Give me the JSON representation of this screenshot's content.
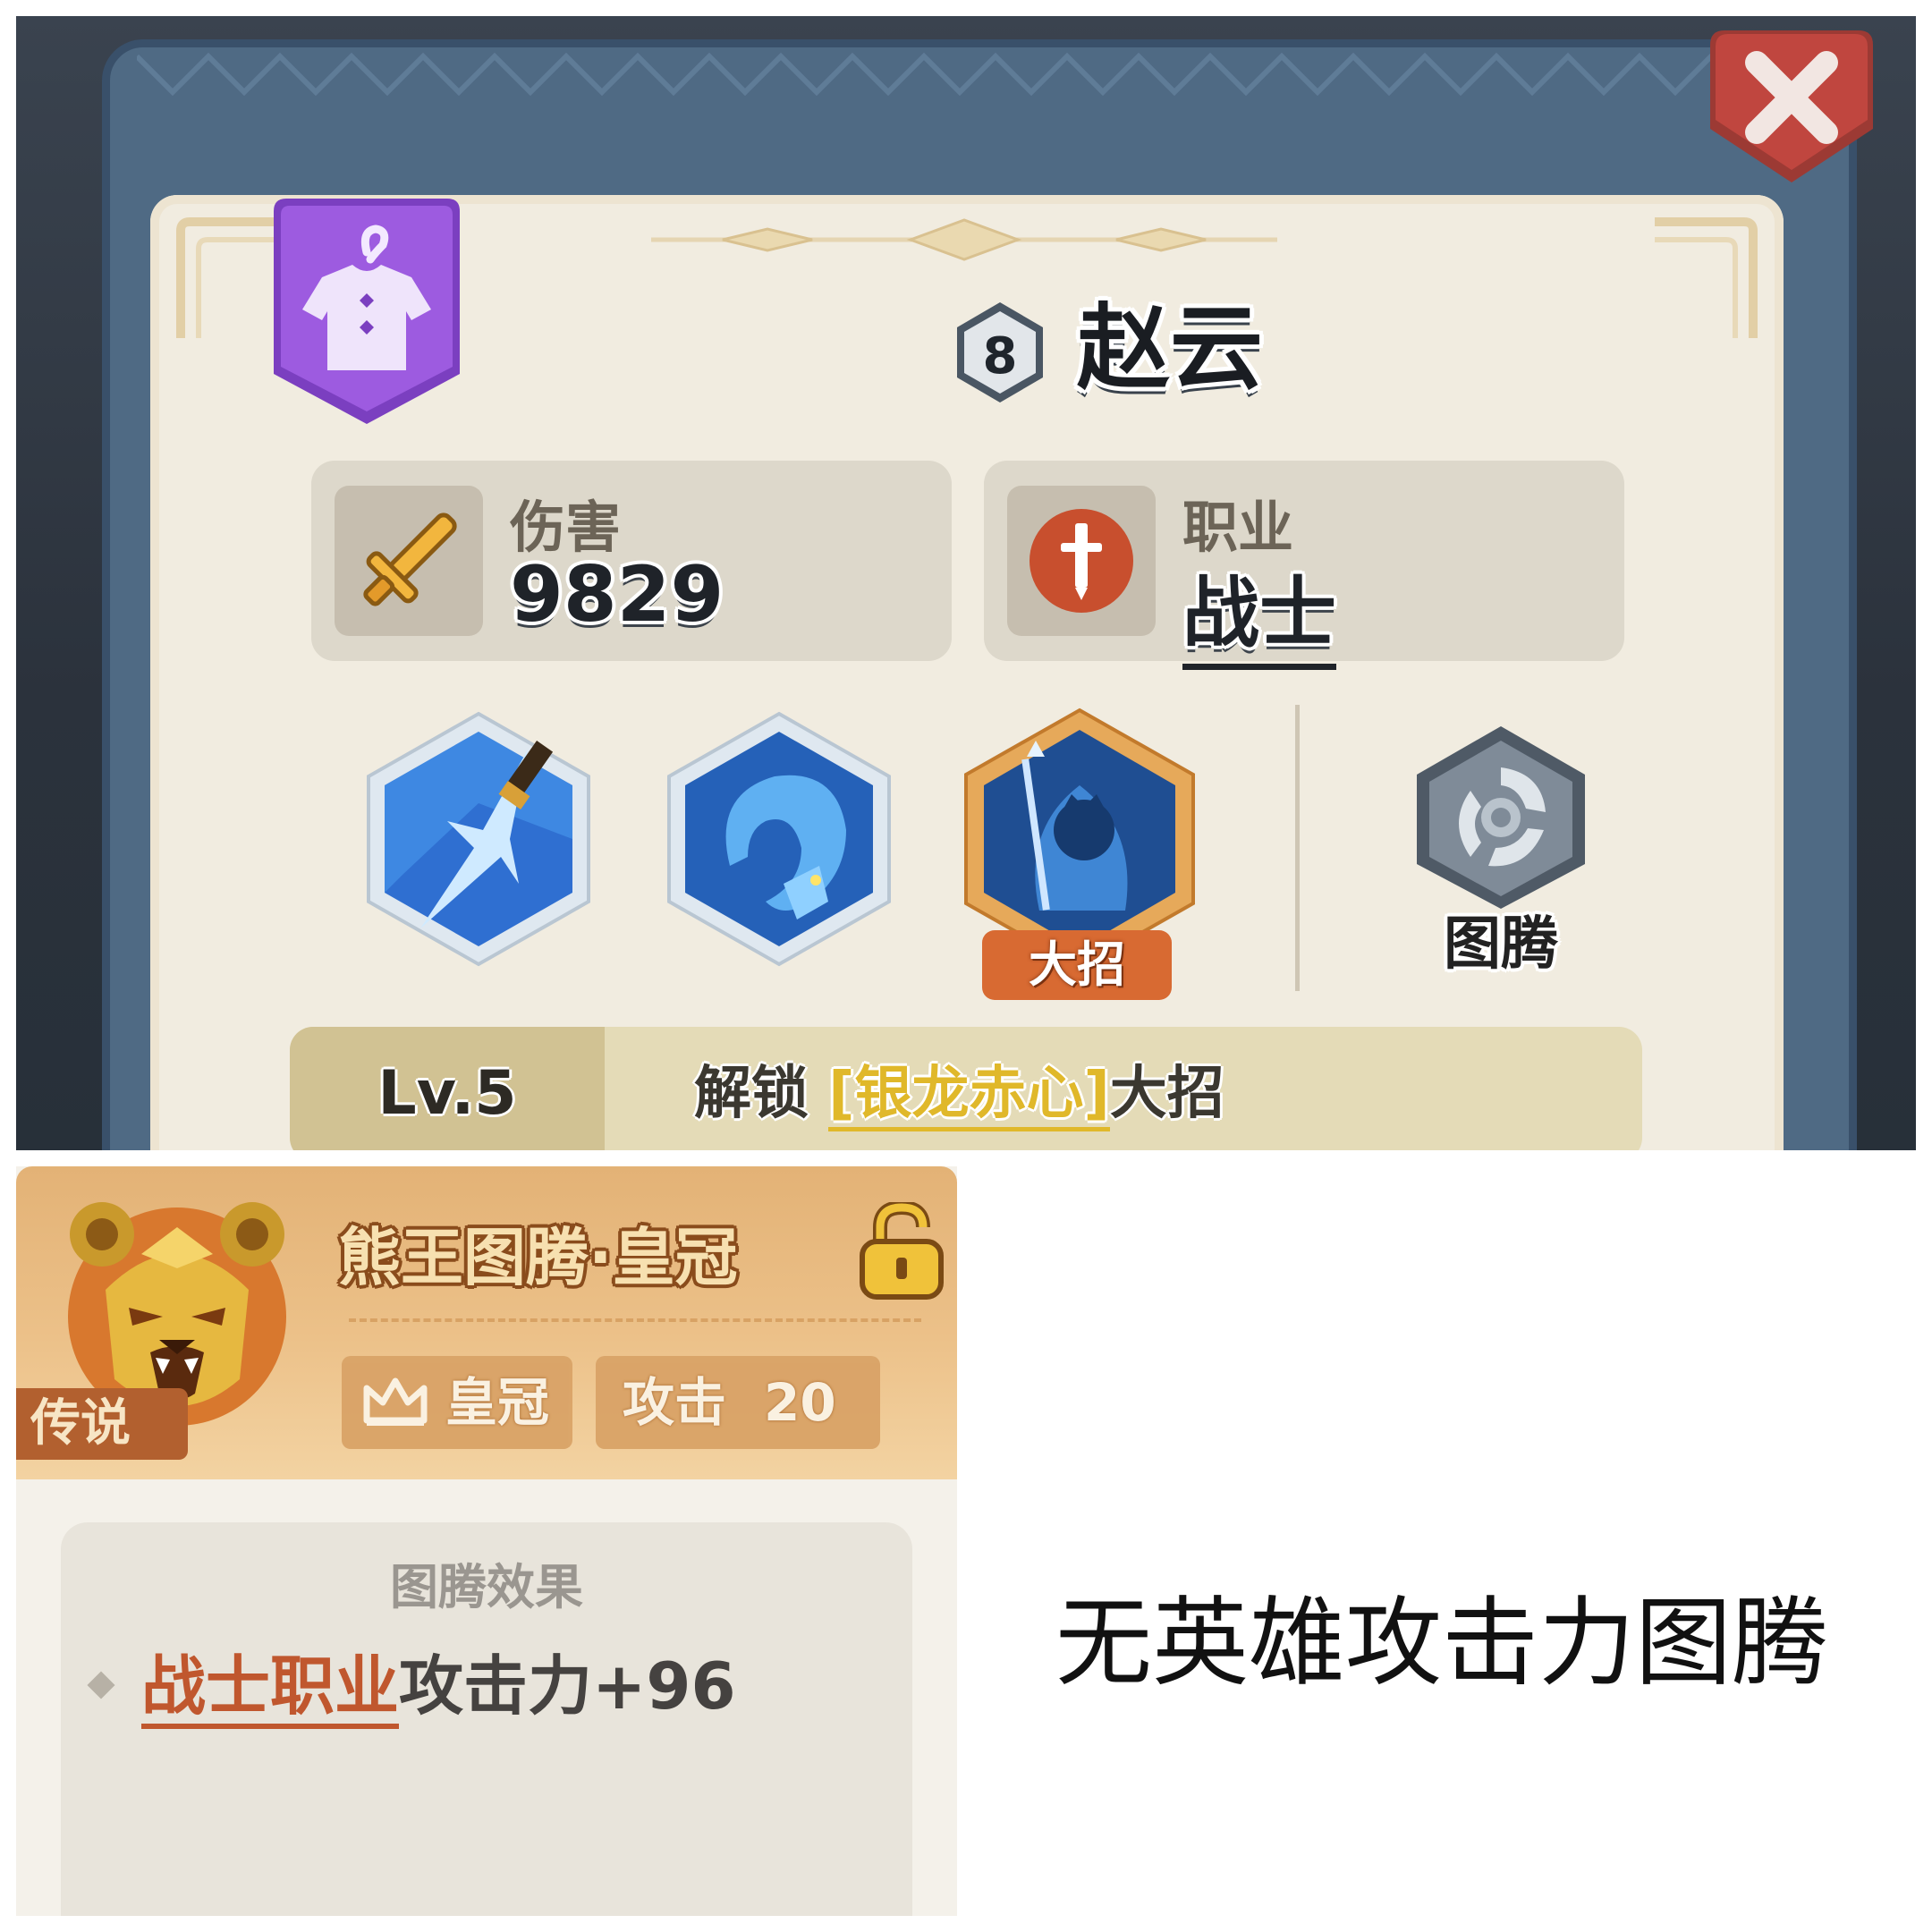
{
  "hero_panel": {
    "level_badge": "8",
    "name": "赵云",
    "damage": {
      "label": "伤害",
      "value": "9829",
      "icon": "sword-icon"
    },
    "job": {
      "label": "职业",
      "value": "战士",
      "icon": "warrior-class-icon"
    },
    "skills": [
      {
        "icon": "spear-strike-skill-icon"
      },
      {
        "icon": "ice-dragon-skill-icon"
      },
      {
        "icon": "ultimate-warrior-skill-icon",
        "tag": "大招"
      }
    ],
    "totem": {
      "label": "图腾",
      "icon": "swirl-totem-icon"
    },
    "level_unlock": {
      "level": "Lv.5",
      "prefix": "解锁",
      "skill_name": "[银龙赤心]",
      "suffix": "大招"
    },
    "outfit_icon": "outfit-shirt-icon",
    "close_icon": "close-icon"
  },
  "totem_card": {
    "rarity": "传说",
    "title": "熊王图腾·皇冠",
    "icon": "bear-king-icon",
    "lock_icon": "unlocked-padlock-icon",
    "tags": [
      {
        "icon": "crown-icon",
        "label": "皇冠"
      },
      {
        "label": "攻击",
        "value": "20"
      }
    ],
    "effect": {
      "heading": "图腾效果",
      "job": "战士职业",
      "text": "攻击力+96"
    }
  },
  "note": "无英雄攻击力图腾",
  "colors": {
    "frame": "#4f6a84",
    "panel": "#f1ece0",
    "outfit_purple": "#9d5be0",
    "close_red": "#c0463f",
    "ultimate_orange": "#d86a32",
    "skill_link_gold": "#e0b82a",
    "job_red": "#c0572e",
    "card_header": "#ecc189",
    "legend_brown": "#b2602f"
  }
}
